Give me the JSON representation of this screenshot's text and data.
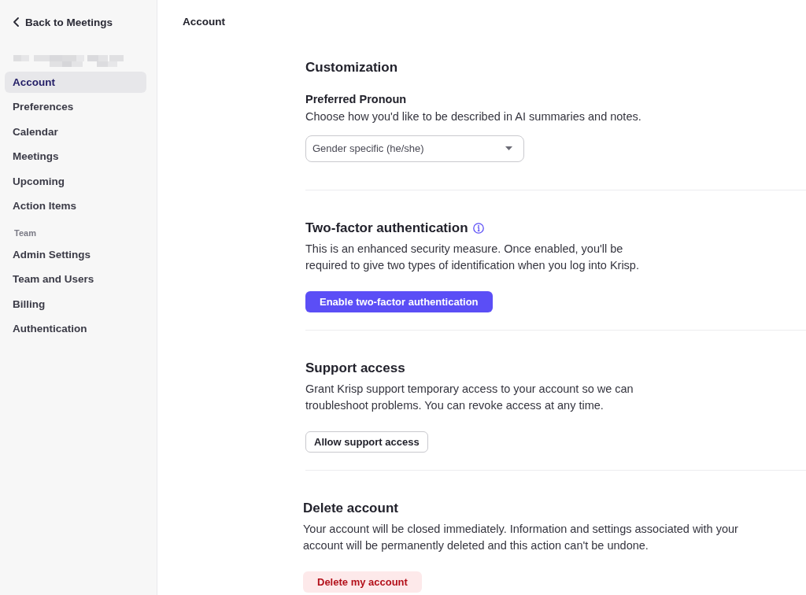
{
  "sidebar": {
    "back_link": {
      "label": "Back to Meetings"
    },
    "groups": [
      {
        "items": [
          {
            "label": "Account",
            "selected": true
          },
          {
            "label": "Preferences",
            "selected": false
          },
          {
            "label": "Calendar",
            "selected": false
          },
          {
            "label": "Meetings",
            "selected": false
          },
          {
            "label": "Upcoming",
            "selected": false
          },
          {
            "label": "Action Items",
            "selected": false
          }
        ]
      },
      {
        "heading": "Team",
        "items": [
          {
            "label": "Admin Settings",
            "selected": false
          },
          {
            "label": "Team and Users",
            "selected": false
          },
          {
            "label": "Billing",
            "selected": false
          },
          {
            "label": "Authentication",
            "selected": false
          }
        ]
      }
    ]
  },
  "header": {
    "title": "Account"
  },
  "sections": [
    {
      "kind": "select",
      "title": "Customization",
      "field_label": "Preferred Pronoun",
      "description": "Choose how you'd like to be described in AI summaries and notes.",
      "select": {
        "value": "Gender specific (he/she)"
      }
    },
    {
      "kind": "action",
      "title": "Two-factor authentication",
      "info": true,
      "description": "This is an enhanced security measure. Once enabled, you'll be required to give two types of identification when you log into Krisp.",
      "button": {
        "label": "Enable two-factor authentication",
        "kind": "primary"
      }
    },
    {
      "kind": "action",
      "title": "Support access",
      "description": "Grant Krisp support temporary access to your account so we can troubleshoot problems. You can revoke access at any time.",
      "button": {
        "label": "Allow support access",
        "kind": "outline"
      }
    },
    {
      "kind": "danger",
      "title": "Delete account",
      "description": "Your account will be closed immediately. Information and settings associated with your account will be permanently deleted and this action can't be undone.",
      "button": {
        "label": "Delete my account",
        "kind": "danger"
      }
    }
  ]
}
